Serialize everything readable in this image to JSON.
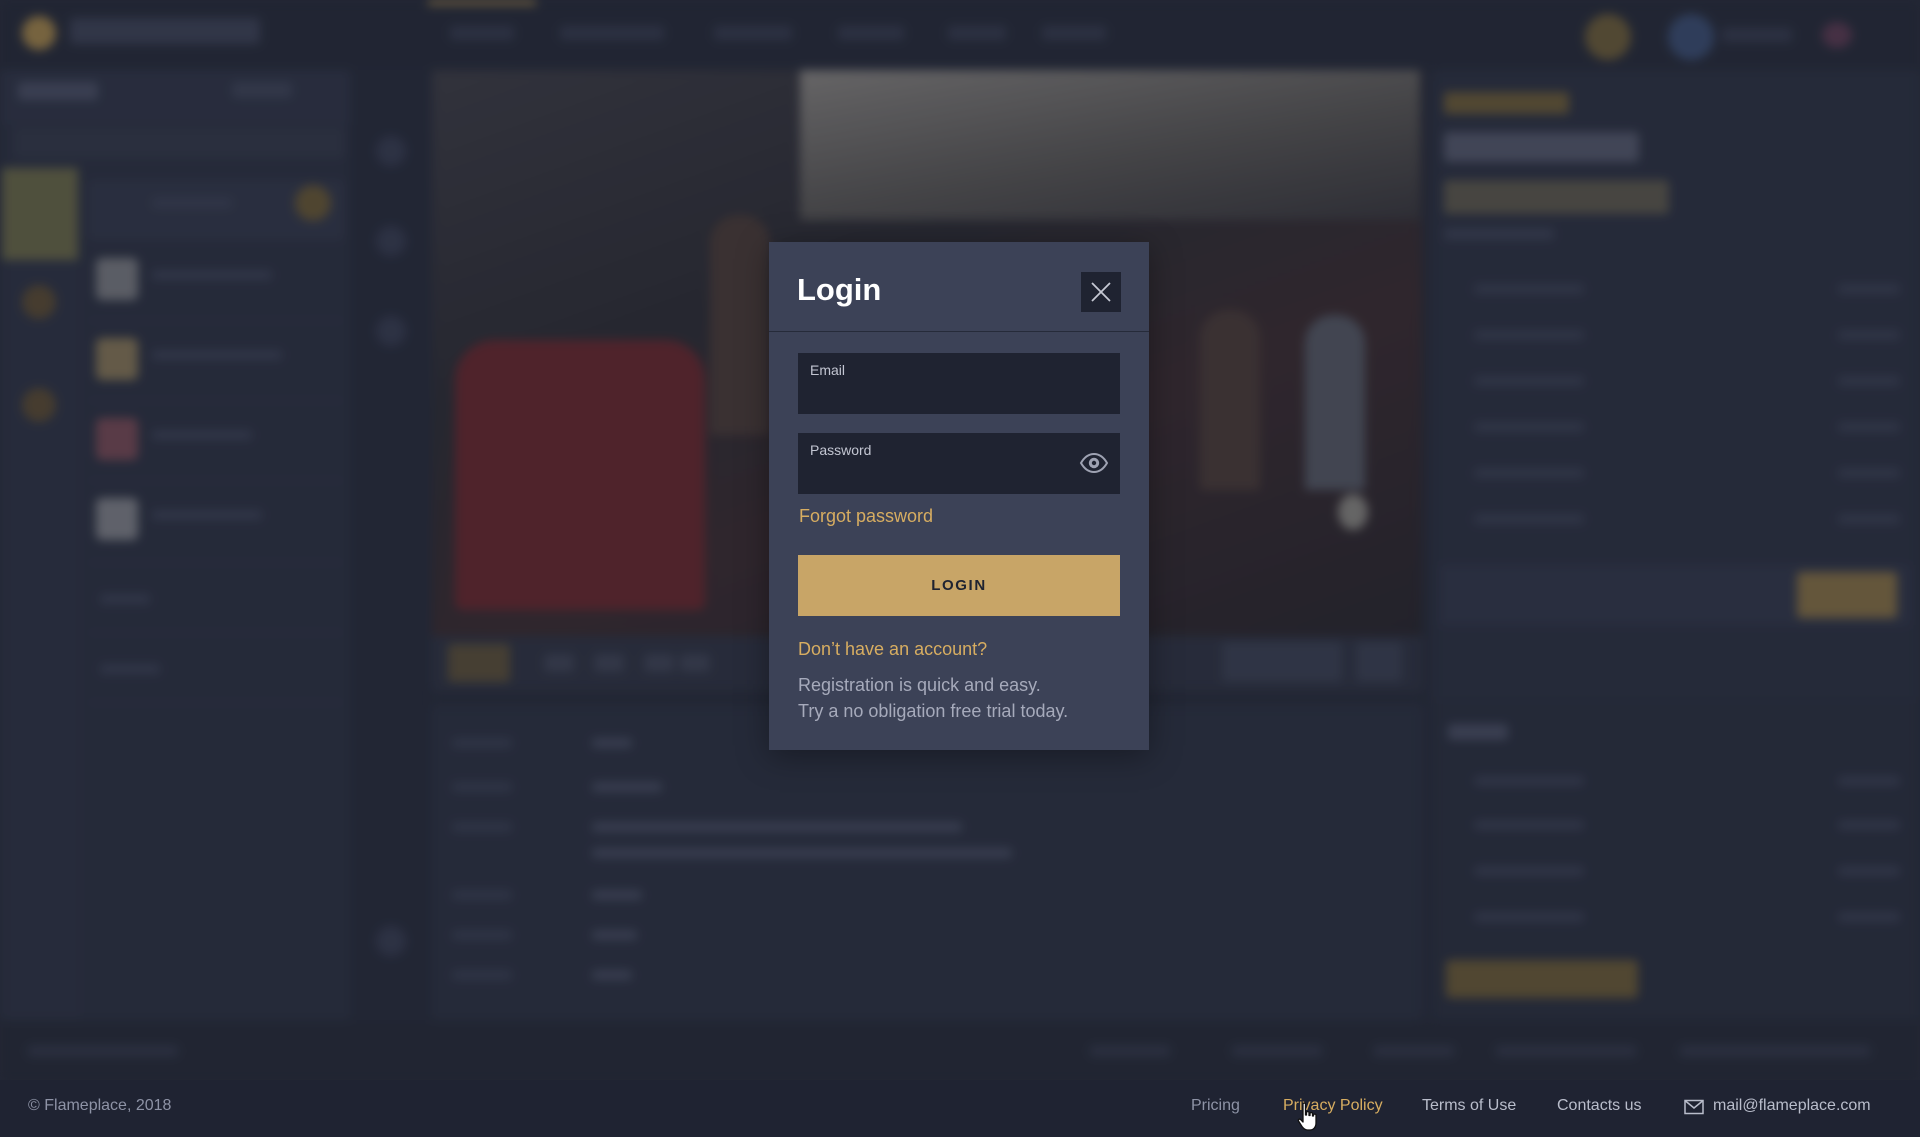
{
  "modal": {
    "title": "Login",
    "email_label": "Email",
    "email_value": "",
    "password_label": "Password",
    "password_value": "",
    "forgot_password": "Forgot password",
    "login_button": "LOGIN",
    "no_account_link": "Don’t have an account?",
    "registration_line1": "Registration is quick and easy.",
    "registration_line2": "Try a no obligation free trial today."
  },
  "footer": {
    "copyright": "© Flameplace, 2018",
    "links": [
      "Pricing",
      "Privacy Policy",
      "Terms of Use",
      "Contacts us"
    ],
    "email": "mail@flameplace.com"
  },
  "colors": {
    "accent": "#d7ad61",
    "button": "#c8a567",
    "modal_bg": "#3c4257",
    "field_bg": "#1f2331",
    "page_bg": "#262b3a"
  },
  "icons": [
    "close-icon",
    "eye-icon",
    "mail-icon",
    "hand-cursor-icon"
  ]
}
